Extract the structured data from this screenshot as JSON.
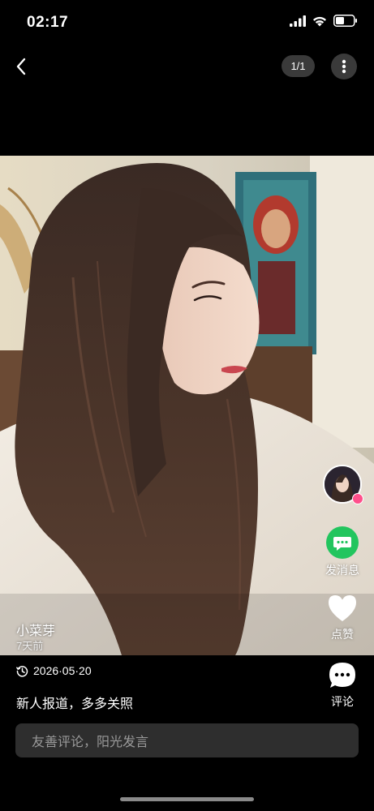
{
  "status_bar": {
    "time": "02:17"
  },
  "nav": {
    "page_counter": "1/1"
  },
  "post": {
    "author_name": "小菜芽",
    "author_time": "7天前",
    "date": "2026·05·20",
    "text": "新人报道，多多关照"
  },
  "actions": {
    "message_label": "发消息",
    "like_label": "点赞",
    "comment_label": "评论"
  },
  "comment_input": {
    "placeholder": "友善评论，阳光发言"
  },
  "colors": {
    "message_green": "#22c55e",
    "avatar_badge": "#ff4f8b",
    "input_bg": "#2e2e2e"
  },
  "icons": [
    "back-icon",
    "more-icon",
    "signal-icon",
    "wifi-icon",
    "battery-icon",
    "chat-bubble-icon",
    "heart-icon",
    "comment-icon",
    "clock-icon"
  ]
}
